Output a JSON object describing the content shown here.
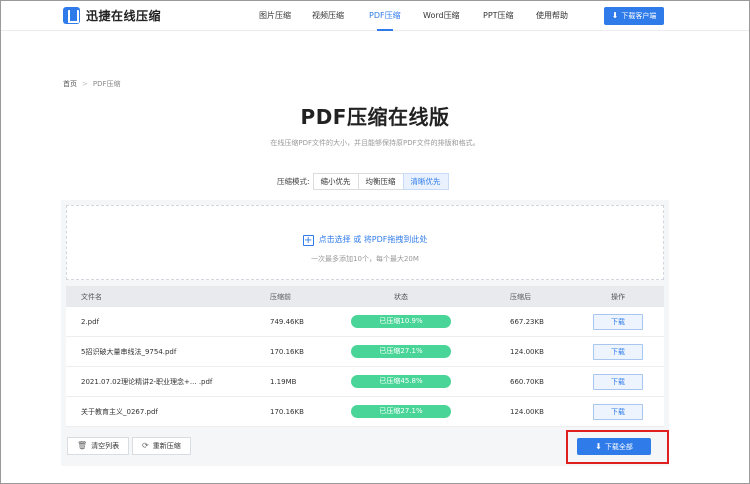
{
  "header": {
    "logo_text": "迅捷在线压缩",
    "nav": [
      {
        "label": "图片压缩"
      },
      {
        "label": "视频压缩"
      },
      {
        "label": "PDF压缩"
      },
      {
        "label": "Word压缩"
      },
      {
        "label": "PPT压缩"
      },
      {
        "label": "使用帮助"
      }
    ],
    "client_button": "下载客户端"
  },
  "breadcrumb": {
    "home": "首页",
    "separator": ">",
    "current": "PDF压缩"
  },
  "title": "PDF压缩在线版",
  "subtitle": "在线压缩PDF文件的大小，并且能够保持原PDF文件的排版和格式。",
  "mode": {
    "label": "压缩模式:",
    "options": [
      "缩小优先",
      "均衡压缩",
      "清晰优先"
    ],
    "selected": "清晰优先"
  },
  "dropzone": {
    "main_text": "点击选择 或 将PDF拖拽到此处",
    "hint": "一次最多添加10个，每个最大20M"
  },
  "table": {
    "headers": {
      "name": "文件名",
      "before": "压缩前",
      "status": "状态",
      "after": "压缩后",
      "op": "操作"
    },
    "rows": [
      {
        "name": "2.pdf",
        "before": "749.46KB",
        "status": "已压缩10.9%",
        "after": "667.23KB",
        "op": "下载"
      },
      {
        "name": "5招识破大量串线法_9754.pdf",
        "before": "170.16KB",
        "status": "已压缩27.1%",
        "after": "124.00KB",
        "op": "下载"
      },
      {
        "name": "2021.07.02理论精讲2-职业理念+...  .pdf",
        "before": "1.19MB",
        "status": "已压缩45.8%",
        "after": "660.70KB",
        "op": "下载"
      },
      {
        "name": "关于教育主义_0267.pdf",
        "before": "170.16KB",
        "status": "已压缩27.1%",
        "after": "124.00KB",
        "op": "下载"
      }
    ]
  },
  "footer": {
    "clear_label": "清空列表",
    "recompress_label": "重新压缩",
    "download_all_label": "下载全部"
  },
  "colors": {
    "accent": "#2f7bea",
    "status_green": "#48d597",
    "highlight": "#e02020"
  }
}
